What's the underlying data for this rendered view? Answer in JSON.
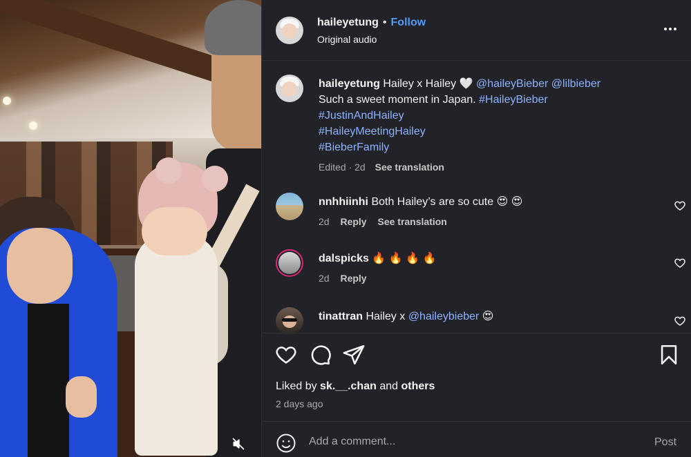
{
  "post": {
    "author": "haileyetung",
    "follow_label": "Follow",
    "separator": "•",
    "audio_label": "Original audio"
  },
  "caption": {
    "username": "haileyetung",
    "text_1": "Hailey x Hailey",
    "heart_emoji": "🤍",
    "mention_1": "@haileyBieber",
    "mention_2": "@lilbieber",
    "text_2": "Such a sweet moment in Japan.",
    "hashtag_1": "#HaileyBieber",
    "hashtag_2": "#JustinAndHailey",
    "hashtag_3": "#HaileyMeetingHailey",
    "hashtag_4": "#BieberFamily",
    "meta": "Edited · 2d",
    "see_translation": "See translation"
  },
  "comments": [
    {
      "username": "nnhhiinhi",
      "text": "Both Hailey’s are so cute",
      "emoji": "😍 😍",
      "age": "2d",
      "reply_label": "Reply",
      "translation_label": "See translation"
    },
    {
      "username": "dalspicks",
      "text": "",
      "emoji": "🔥 🔥 🔥 🔥",
      "age": "2d",
      "reply_label": "Reply"
    },
    {
      "username": "tinattran",
      "text": "Hailey x",
      "mention": "@haileybieber",
      "emoji": "😍"
    }
  ],
  "likes": {
    "prefix": "Liked by",
    "user": "sk.__.chan",
    "joiner": "and",
    "others": "others",
    "date": "2 days ago"
  },
  "add_comment": {
    "placeholder": "Add a comment...",
    "post_label": "Post"
  },
  "icons": {
    "mute": "speaker-muted-icon",
    "like": "heart-icon",
    "comment": "comment-bubble-icon",
    "share": "paper-plane-icon",
    "save": "bookmark-icon",
    "emoji": "smiley-icon",
    "more": "more-dots-icon"
  },
  "colors": {
    "panel_bg": "#212328",
    "link": "#8fb2ff",
    "follow": "#4f9cf9",
    "muted_text": "#a8a8a8"
  }
}
